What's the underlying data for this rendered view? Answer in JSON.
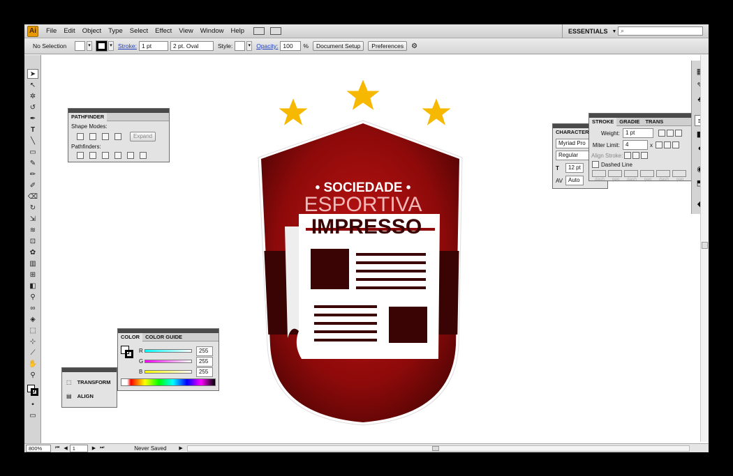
{
  "app": {
    "logo": "Ai"
  },
  "menubar": {
    "items": [
      "File",
      "Edit",
      "Object",
      "Type",
      "Select",
      "Effect",
      "View",
      "Window",
      "Help"
    ],
    "workspace": "ESSENTIALS",
    "workspace_arrow": "▼",
    "search_placeholder": "⌕"
  },
  "control_bar": {
    "selection": "No Selection",
    "stroke_label": "Stroke:",
    "stroke_weight": "1 pt",
    "brush": "2 pt. Oval",
    "style_label": "Style:",
    "opacity_label": "Opacity:",
    "opacity_value": "100",
    "opacity_unit": "%",
    "document_setup": "Document Setup",
    "preferences": "Preferences"
  },
  "pathfinder": {
    "title": "PATHFINDER",
    "shape_modes": "Shape Modes:",
    "expand": "Expand",
    "pathfinders": "Pathfinders:"
  },
  "color_panel": {
    "tab_color": "COLOR",
    "tab_guide": "COLOR GUIDE",
    "channels": [
      {
        "label": "R",
        "value": "255",
        "color": "#22c5c5"
      },
      {
        "label": "G",
        "value": "255",
        "color": "#c53bc5"
      },
      {
        "label": "B",
        "value": "255",
        "color": "#d6d61e"
      }
    ]
  },
  "transform_panel": {
    "transform": "TRANSFORM",
    "align": "ALIGN"
  },
  "character_panel": {
    "title": "CHARACTER",
    "font": "Myriad Pro",
    "style": "Regular",
    "size": "12 pt",
    "tracking": "Auto"
  },
  "stroke_panel": {
    "tab_stroke": "STROKE",
    "tab_gradient": "GRADIE",
    "tab_transparency": "TRANS",
    "weight_label": "Weight:",
    "weight_value": "1 pt",
    "miter_label": "Miter Limit:",
    "miter_value": "4",
    "miter_x": "x",
    "align_label": "Align Stroke:",
    "dashed_label": "Dashed Line",
    "dash_labels": [
      "dash",
      "gap",
      "dash",
      "gap",
      "dash",
      "gap"
    ]
  },
  "status_bar": {
    "zoom": "800%",
    "artboard": "1",
    "status": "Never Saved"
  },
  "artwork": {
    "line1": "• SOCIEDADE •",
    "line2": "ESPORTIVA",
    "line3": "IMPRESSO",
    "shield_color": "#8e0a0a",
    "band_color": "#3a0404",
    "star_color": "#f6b800"
  }
}
